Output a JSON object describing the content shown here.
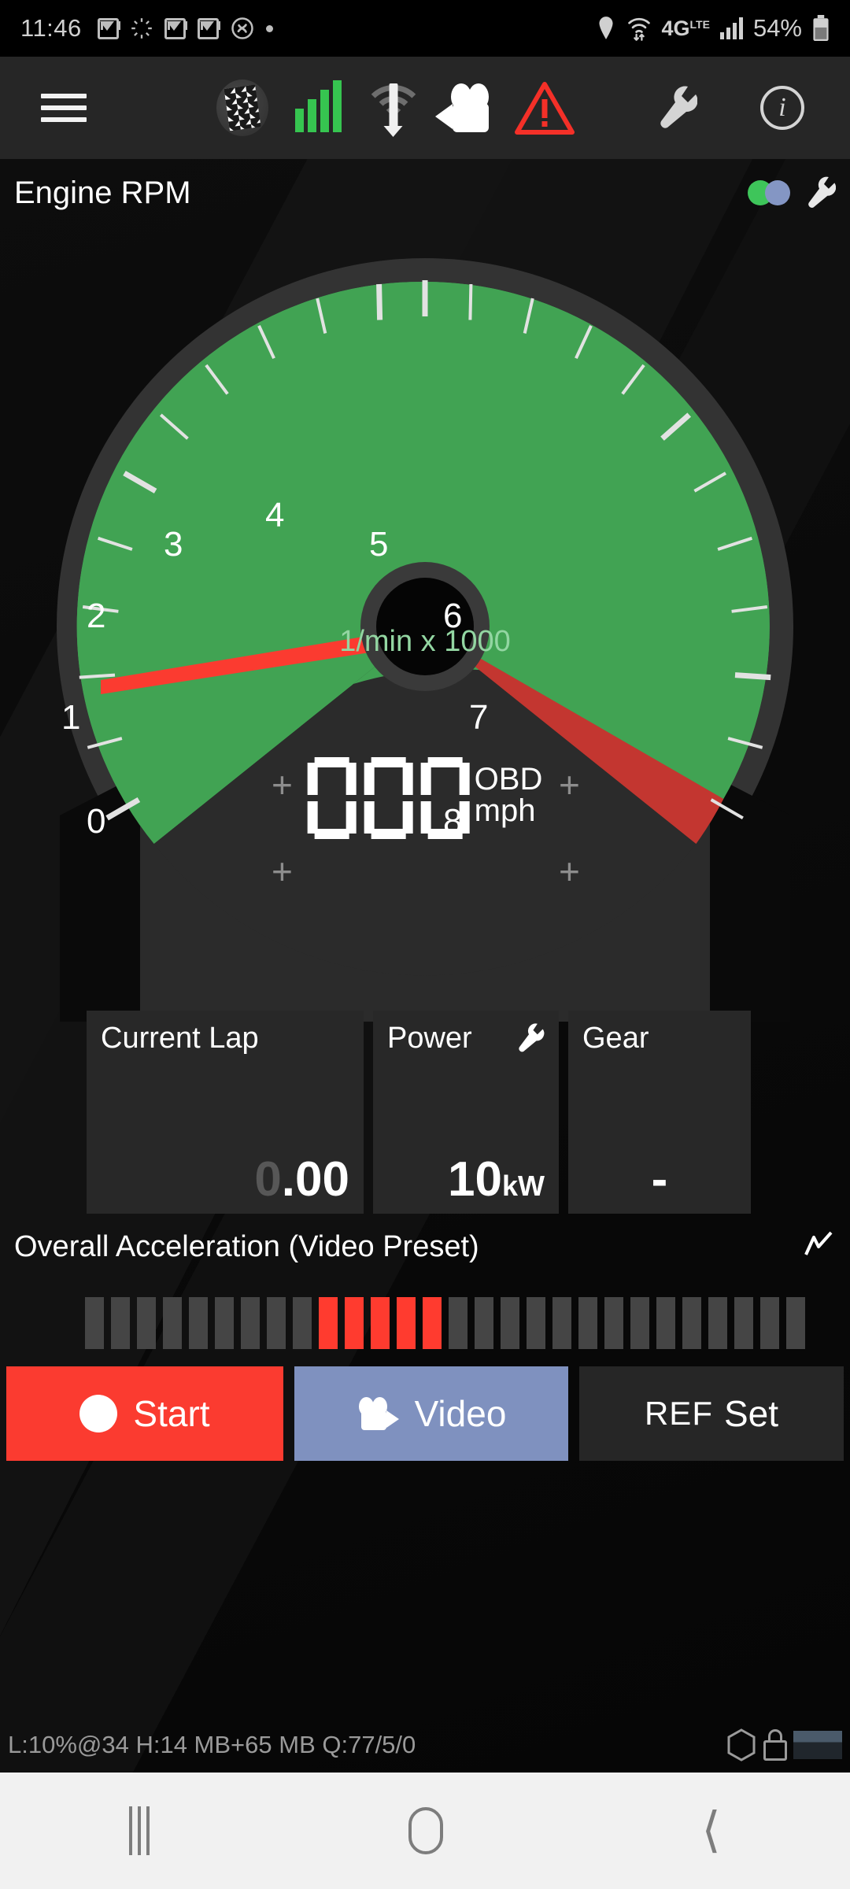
{
  "status_bar": {
    "time": "11:46",
    "battery_percent": "54%",
    "network_type": "4G",
    "network_sub": "LTE",
    "icons": [
      "gmail-icon",
      "loading-spinner-icon",
      "gmail-icon",
      "gmail-icon",
      "shazam-icon",
      "dot-icon",
      "location-pin-icon",
      "wifi-transfer-icon",
      "signal-bars-icon",
      "battery-icon"
    ]
  },
  "toolbar": {
    "menu_label": "Menu",
    "items": [
      {
        "name": "checkered-flag-icon",
        "label": "Session"
      },
      {
        "name": "signal-bars-icon",
        "label": "GPS Signal"
      },
      {
        "name": "gps-wifi-icon",
        "label": "Connection"
      },
      {
        "name": "video-camera-icon",
        "label": "Video"
      },
      {
        "name": "warning-triangle-icon",
        "label": "Warning"
      },
      {
        "name": "wrench-icon",
        "label": "Settings"
      },
      {
        "name": "info-icon",
        "label": "Info"
      }
    ]
  },
  "gauge_panel": {
    "title": "Engine RPM",
    "status_dots": [
      "green",
      "blue"
    ],
    "settings_icon": "wrench-icon"
  },
  "chart_data": {
    "type": "gauge",
    "title": "Engine RPM",
    "unit_label": "1/min x 1000",
    "min": 0,
    "max": 8,
    "tick_labels": [
      "0",
      "1",
      "2",
      "3",
      "4",
      "5",
      "6",
      "7",
      "8"
    ],
    "needle_value": 1.35,
    "green_zone": [
      0,
      6
    ],
    "red_zone": [
      6,
      8
    ],
    "colors": {
      "green": "#41a353",
      "red": "#c33630",
      "needle": "#fb3b30",
      "bezel": "#333333"
    },
    "digital_readout": {
      "value": "000",
      "source": "OBD",
      "unit": "mph"
    }
  },
  "cards": [
    {
      "label": "Current Lap",
      "value_dim": "0",
      "value": ".00",
      "unit": "",
      "icon": null
    },
    {
      "label": "Power",
      "value_dim": "",
      "value": "10",
      "unit": "kW",
      "icon": "wrench-icon"
    },
    {
      "label": "Gear",
      "value_dim": "",
      "value": "-",
      "unit": "",
      "icon": null
    }
  ],
  "accel": {
    "title": "Overall Acceleration (Video Preset)",
    "chart_icon": "line-chart-icon",
    "meter": {
      "total_bars": 28,
      "active_indices": [
        9,
        10,
        11,
        12,
        13
      ],
      "active_color": "#ff3b2f",
      "inactive_color": "#454545"
    }
  },
  "buttons": {
    "start": {
      "label": "Start",
      "icon": "record-dot-icon",
      "color": "#fb3b30"
    },
    "video": {
      "label": "Video",
      "icon": "video-camera-icon",
      "color": "#7f91bf"
    },
    "ref": {
      "prefix": "REF",
      "label": "Set",
      "color": "#262626"
    }
  },
  "footer": {
    "status_text": "L:10%@34 H:14 MB+65 MB Q:77/5/0",
    "icons": [
      "hexagon-icon",
      "lock-icon",
      "video-thumbnail"
    ]
  },
  "nav_bar": {
    "recent_label": "Recent apps",
    "home_label": "Home",
    "back_label": "Back"
  }
}
